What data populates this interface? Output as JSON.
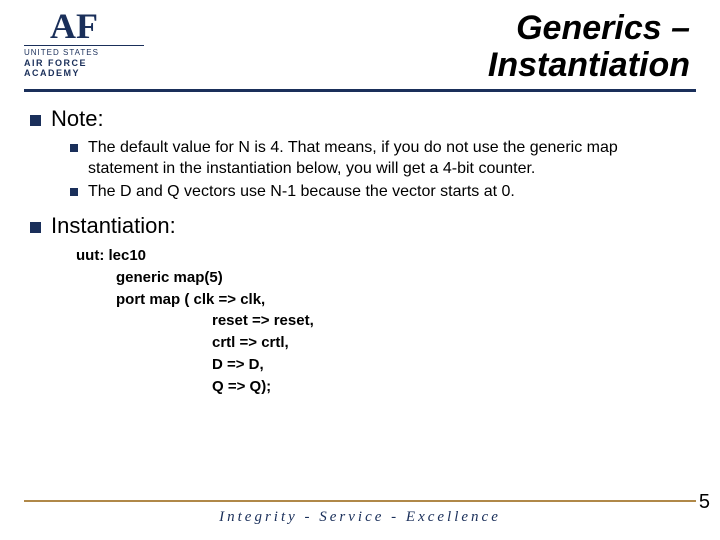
{
  "logo": {
    "monogram": "AF",
    "line1": "UNITED STATES",
    "line2": "AIR FORCE",
    "line3": "ACADEMY"
  },
  "title": {
    "line1": "Generics –",
    "line2": "Instantiation"
  },
  "section1": {
    "heading": "Note:",
    "items": [
      "The default value for N is 4. That means, if you do not use the generic map statement in the instantiation below, you will get a 4-bit counter.",
      "The D and Q vectors use N-1 because the vector starts at 0."
    ]
  },
  "section2": {
    "heading": "Instantiation:",
    "code": {
      "l0": "uut: lec10",
      "l1": "generic map(5)",
      "l2": "port map (  clk => clk,",
      "l3": "reset => reset,",
      "l4": "crtl => crtl,",
      "l5": "D => D,",
      "l6": "Q => Q);"
    }
  },
  "footer": "Integrity - Service - Excellence",
  "page": "5"
}
